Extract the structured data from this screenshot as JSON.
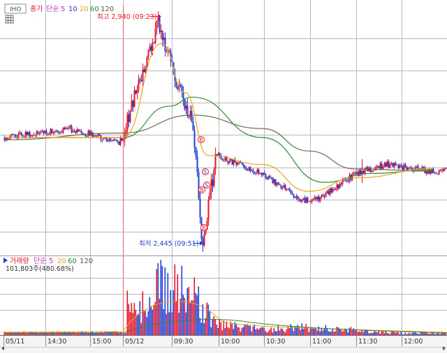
{
  "header": {
    "symbol": "IHO",
    "price_label": "종가",
    "ma_label": "단순",
    "ma_periods": [
      "5",
      "10",
      "20",
      "60",
      "120"
    ]
  },
  "annotations": {
    "high": "최고 2,940 (09:23)",
    "low": "최저 2,445 (09:51)"
  },
  "volume_header": {
    "label": "거래량",
    "ma_label": "단순",
    "ma_periods": [
      "5",
      "20",
      "60",
      "120"
    ],
    "value": "101,803주(480.68%)"
  },
  "colors": {
    "up": "#e5142a",
    "down": "#1f3fd6",
    "ma5": "#c02fc0",
    "ma10": "#2b2bd0",
    "ma20": "#f0a020",
    "ma60": "#2e8b2e",
    "ma120": "#6b6b4a",
    "grid": "#b8b8b8"
  },
  "chart_data": {
    "type": "line",
    "title": "",
    "xlabel": "",
    "ylabel": "",
    "x_ticks": [
      "05/11",
      "14:30",
      "15:00",
      "05/12",
      "09:30",
      "10:00",
      "10:30",
      "11:00",
      "11:30",
      "12:00"
    ],
    "series": [
      {
        "name": "종가",
        "x": [
          "05/11 14:00",
          "05/11 14:45",
          "05/11 15:20",
          "05/12 09:00",
          "09:10",
          "09:23",
          "09:35",
          "09:45",
          "09:51",
          "10:00",
          "10:30",
          "10:55",
          "11:05",
          "11:30",
          "11:50",
          "12:20"
        ],
        "values": [
          2680,
          2700,
          2670,
          2680,
          2800,
          2940,
          2790,
          2720,
          2445,
          2640,
          2600,
          2540,
          2540,
          2600,
          2620,
          2605
        ]
      },
      {
        "name": "단순 20",
        "x": [
          "05/12 09:00",
          "09:25",
          "09:40",
          "09:55",
          "10:30",
          "11:00",
          "11:30",
          "12:20"
        ],
        "values": [
          2680,
          2890,
          2780,
          2640,
          2620,
          2560,
          2590,
          2610
        ]
      },
      {
        "name": "단순 60",
        "x": [
          "05/12 09:00",
          "09:30",
          "09:45",
          "10:30",
          "11:10",
          "11:40",
          "12:20"
        ],
        "values": [
          2680,
          2750,
          2770,
          2680,
          2580,
          2600,
          2608
        ]
      },
      {
        "name": "단순 120",
        "x": [
          "05/11 14:00",
          "05/12 09:00",
          "09:45",
          "10:30",
          "11:00",
          "11:30",
          "12:20"
        ],
        "values": [
          2675,
          2690,
          2730,
          2700,
          2650,
          2610,
          2605
        ]
      }
    ],
    "volume": {
      "name": "거래량",
      "x": [
        "05/12 09:02",
        "09:10",
        "09:23",
        "09:35",
        "09:45",
        "09:50",
        "10:00",
        "10:30",
        "11:00",
        "12:00"
      ],
      "values": [
        60000,
        52000,
        101803,
        95000,
        78000,
        60000,
        22000,
        12000,
        16000,
        4000
      ]
    },
    "grid": true
  }
}
